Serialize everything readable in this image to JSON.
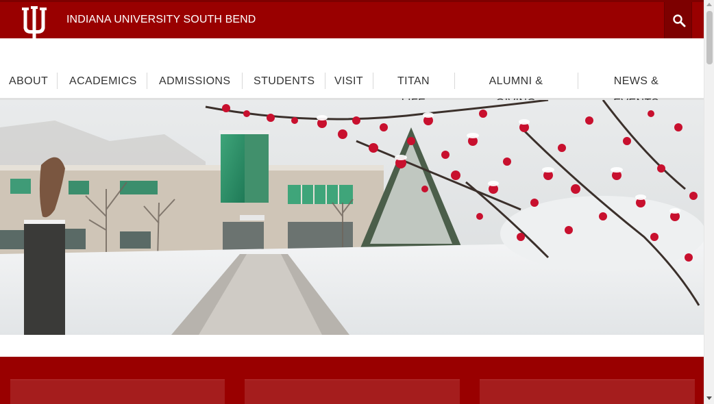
{
  "header": {
    "site_title": "INDIANA UNIVERSITY SOUTH BEND",
    "logo_icon": "iu-trident-icon",
    "search_icon": "search-icon"
  },
  "nav": {
    "items": [
      {
        "label": "ABOUT"
      },
      {
        "label": "ACADEMICS"
      },
      {
        "label": "ADMISSIONS"
      },
      {
        "label": "STUDENTS"
      },
      {
        "label": "VISIT"
      },
      {
        "label": "TITAN LIFE"
      },
      {
        "label": "ALUMNI & GIVING"
      },
      {
        "label": "NEWS & EVENTS"
      }
    ]
  },
  "colors": {
    "brand_crimson": "#990000",
    "dark_crimson": "#7d0000",
    "nav_text": "#333333"
  }
}
